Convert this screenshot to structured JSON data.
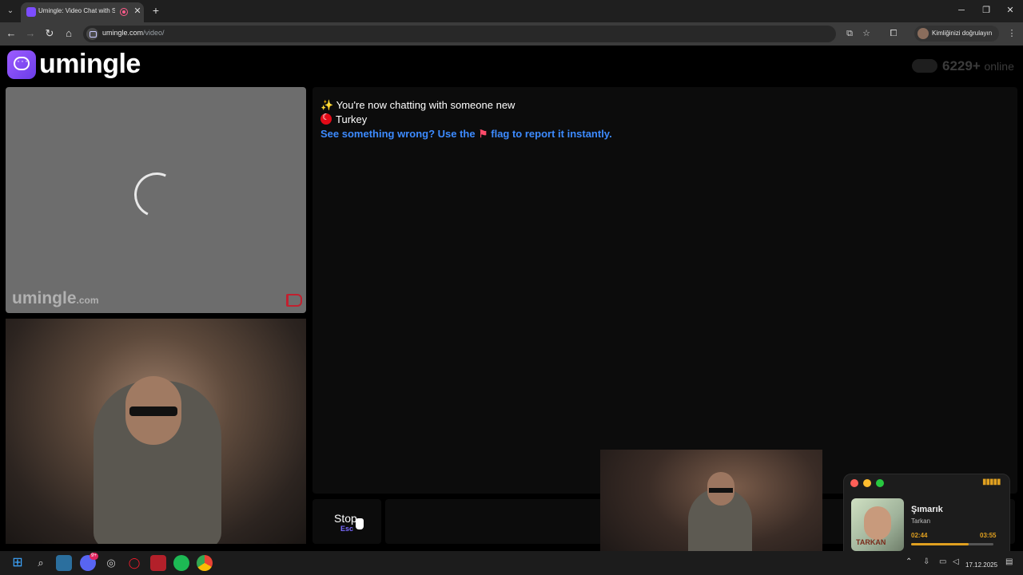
{
  "browser": {
    "tab": {
      "title": "Umingle: Video Chat with S"
    },
    "url": {
      "host": "umingle.com",
      "path": "/video/"
    },
    "profile_label": "Kimliğinizi doğrulayın"
  },
  "site": {
    "logo_text": "umingle",
    "online_count": "6229+",
    "online_word": "online"
  },
  "stranger_video": {
    "watermark": "umingle",
    "watermark_suffix": ".com"
  },
  "chat": {
    "intro": "You're now chatting with someone new",
    "country": "Turkey",
    "report_hint_before": "See something wrong? Use the",
    "report_hint_after": "flag to report it instantly."
  },
  "controls": {
    "stop_label": "Stop",
    "stop_key": "Esc"
  },
  "music_widget": {
    "song": "Şımarık",
    "artist": "Tarkan",
    "album_label": "TARKAN",
    "elapsed": "02:44",
    "duration": "03:55",
    "progress_fraction": 0.7
  },
  "taskbar": {
    "date": "17.12.2025",
    "discord_badge": "9+"
  },
  "colors": {
    "brand": "#7c4dff",
    "report_link": "#3d8bff",
    "music_accent": "#e0a020"
  },
  "icons": [
    "tab-search-icon",
    "close-icon",
    "plus-icon",
    "minimize-icon",
    "restore-icon",
    "back-icon",
    "forward-icon",
    "reload-icon",
    "home-icon",
    "translate-icon",
    "star-icon",
    "extensions-icon",
    "menu-icon",
    "chat-bubble-icon",
    "flag-icon",
    "sparkle-icon",
    "turkey-flag-icon",
    "windows-icon",
    "search-icon",
    "spotify-icon",
    "chrome-icon"
  ]
}
